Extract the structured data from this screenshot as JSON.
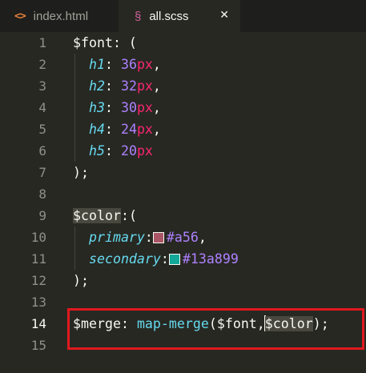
{
  "tabs": [
    {
      "icon": "<>",
      "label": "index.html"
    },
    {
      "icon": "§",
      "label": "all.scss",
      "close": "✕"
    }
  ],
  "lines": [
    {
      "n": "1",
      "tokens": [
        [
          "var",
          "$font"
        ],
        [
          "punct",
          ": ("
        ]
      ]
    },
    {
      "n": "2",
      "tokens": [
        [
          "punct",
          "  "
        ],
        [
          "key",
          "h1"
        ],
        [
          "punct",
          ": "
        ],
        [
          "num",
          "36"
        ],
        [
          "unit",
          "px"
        ],
        [
          "punct",
          ","
        ]
      ]
    },
    {
      "n": "3",
      "tokens": [
        [
          "punct",
          "  "
        ],
        [
          "key",
          "h2"
        ],
        [
          "punct",
          ": "
        ],
        [
          "num",
          "32"
        ],
        [
          "unit",
          "px"
        ],
        [
          "punct",
          ","
        ]
      ]
    },
    {
      "n": "4",
      "tokens": [
        [
          "punct",
          "  "
        ],
        [
          "key",
          "h3"
        ],
        [
          "punct",
          ": "
        ],
        [
          "num",
          "30"
        ],
        [
          "unit",
          "px"
        ],
        [
          "punct",
          ","
        ]
      ]
    },
    {
      "n": "5",
      "tokens": [
        [
          "punct",
          "  "
        ],
        [
          "key",
          "h4"
        ],
        [
          "punct",
          ": "
        ],
        [
          "num",
          "24"
        ],
        [
          "unit",
          "px"
        ],
        [
          "punct",
          ","
        ]
      ]
    },
    {
      "n": "6",
      "tokens": [
        [
          "punct",
          "  "
        ],
        [
          "key",
          "h5"
        ],
        [
          "punct",
          ": "
        ],
        [
          "num",
          "20"
        ],
        [
          "unit",
          "px"
        ]
      ]
    },
    {
      "n": "7",
      "tokens": [
        [
          "punct",
          ");"
        ]
      ]
    },
    {
      "n": "8",
      "tokens": []
    },
    {
      "n": "9",
      "tokens": [
        [
          "var sel-bg",
          "$color"
        ],
        [
          "punct",
          ":("
        ]
      ]
    },
    {
      "n": "10",
      "tokens": [
        [
          "punct",
          "  "
        ],
        [
          "key",
          "primary"
        ],
        [
          "punct",
          ":"
        ],
        [
          "swatch",
          "#aa5566"
        ],
        [
          "hex",
          "#a56"
        ],
        [
          "punct",
          ","
        ]
      ]
    },
    {
      "n": "11",
      "tokens": [
        [
          "punct",
          "  "
        ],
        [
          "key",
          "secondary"
        ],
        [
          "punct",
          ":"
        ],
        [
          "swatch",
          "#13a899"
        ],
        [
          "hex",
          "#13a899"
        ]
      ]
    },
    {
      "n": "12",
      "tokens": [
        [
          "punct",
          ");"
        ]
      ]
    },
    {
      "n": "13",
      "tokens": []
    },
    {
      "n": "14",
      "tokens": [
        [
          "var",
          "$merge"
        ],
        [
          "punct",
          ": "
        ],
        [
          "fn",
          "map-merge"
        ],
        [
          "punct",
          "($font,"
        ],
        [
          "cursor",
          ""
        ],
        [
          "var sel-bg",
          "$color"
        ],
        [
          "punct",
          ");"
        ]
      ],
      "current": true
    },
    {
      "n": "15",
      "tokens": []
    }
  ]
}
